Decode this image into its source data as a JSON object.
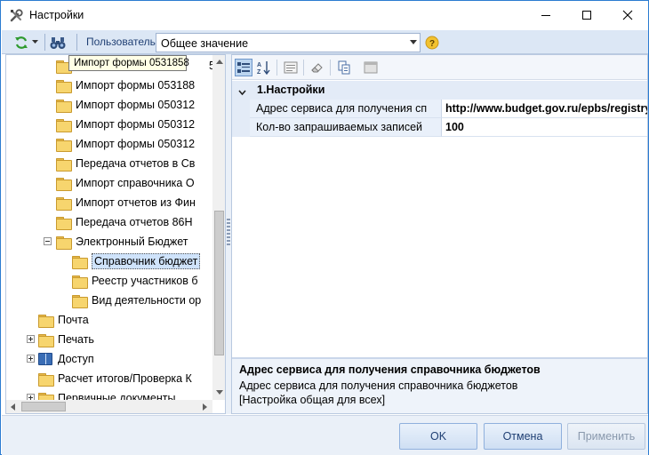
{
  "window": {
    "title": "Настройки"
  },
  "toolbar": {
    "user_label": "Пользователь",
    "scope_value": "Общее значение"
  },
  "tree": {
    "tooltip": "Импорт формы 0531858",
    "partial_top_label": "5",
    "items": [
      {
        "label": "Импорт формы 053188"
      },
      {
        "label": "Импорт формы 050312"
      },
      {
        "label": "Импорт формы 050312"
      },
      {
        "label": "Импорт формы 050312"
      },
      {
        "label": "Передача отчетов в Св"
      },
      {
        "label": "Импорт справочника О"
      },
      {
        "label": "Импорт отчетов из Фин"
      },
      {
        "label": "Передача отчетов 86Н"
      },
      {
        "label": "Электронный Бюджет"
      },
      {
        "label": "Справочник бюджет"
      },
      {
        "label": "Реестр участников б"
      },
      {
        "label": "Вид деятельности ор"
      },
      {
        "label": "Почта"
      },
      {
        "label": "Печать"
      },
      {
        "label": "Доступ"
      },
      {
        "label": "Расчет итогов/Проверка К"
      },
      {
        "label": "Первичные документы"
      }
    ]
  },
  "properties": {
    "category": "1.Настройки",
    "rows": [
      {
        "name": "Адрес сервиса для получения сп",
        "value": "http://www.budget.gov.ru/epbs/registry/"
      },
      {
        "name": "Кол-во запрашиваемых записей",
        "value": "100"
      }
    ],
    "description": {
      "title": "Адрес сервиса для получения справочника бюджетов",
      "line1": "Адрес сервиса для получения справочника бюджетов",
      "line2": "[Настройка общая для всех]"
    }
  },
  "buttons": {
    "ok": "OK",
    "cancel": "Отмена",
    "apply": "Применить"
  },
  "colors": {
    "accent": "#2b7bd1",
    "toolbar_bg": "#dce7f5",
    "selection": "#cfe3fb"
  }
}
